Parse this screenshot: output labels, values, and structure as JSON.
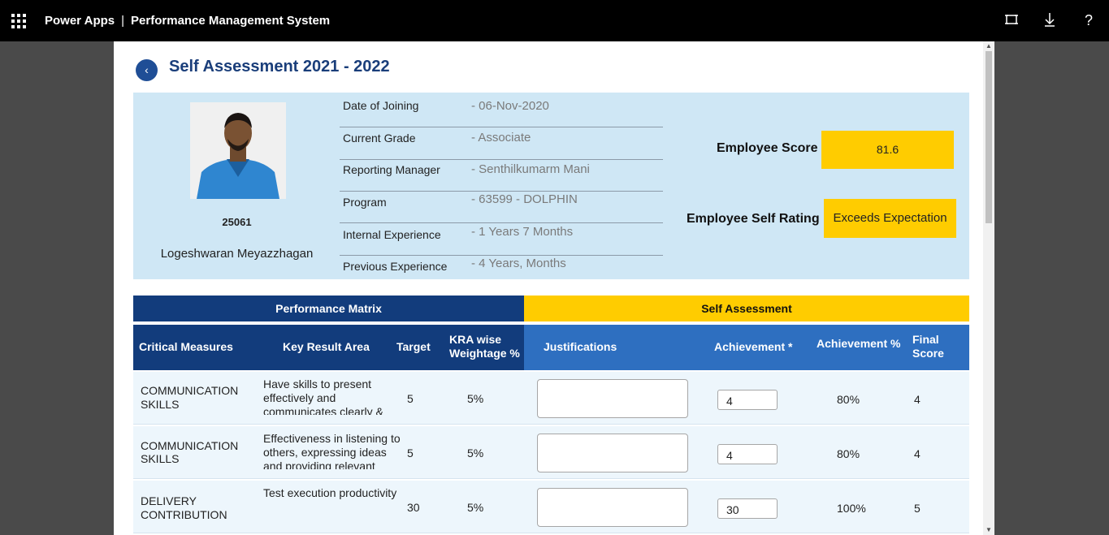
{
  "topbar": {
    "app_name": "Power Apps",
    "separator": "|",
    "app_title": "Performance Management System"
  },
  "page": {
    "title": "Self Assessment 2021 - 2022"
  },
  "employee": {
    "id": "25061",
    "name": "Logeshwaran Meyazzhagan",
    "details": [
      {
        "label": "Date of Joining",
        "value": "- 06-Nov-2020"
      },
      {
        "label": "Current Grade",
        "value": "- Associate"
      },
      {
        "label": "Reporting Manager",
        "value": "- Senthilkumarm Mani"
      },
      {
        "label": "Program",
        "value": "- 63599 - DOLPHIN"
      },
      {
        "label": "Internal Experience",
        "value": "- 1 Years   7 Months"
      },
      {
        "label": "Previous Experience",
        "value": "- 4 Years,  Months"
      }
    ],
    "score_label": "Employee Score",
    "score_value": "81.6",
    "rating_label": "Employee Self Rating",
    "rating_value": "Exceeds Expectation"
  },
  "table": {
    "band_left": "Performance Matrix",
    "band_right": "Self Assessment",
    "headers": {
      "critical_measures": "Critical Measures",
      "key_result_area": "Key Result Area",
      "target": "Target",
      "kra_weightage_1": "KRA wise",
      "kra_weightage_2": "Weightage %",
      "justifications": "Justifications",
      "achievement": "Achievement *",
      "achievement_pct": "Achievement %",
      "final_score_1": "Final",
      "final_score_2": "Score"
    },
    "rows": [
      {
        "measure_1": "COMMUNICATION",
        "measure_2": "SKILLS",
        "kra": "Have skills to present effectively and communicates clearly & effectively",
        "target": "5",
        "weight": "5%",
        "justification": "",
        "achievement": "4",
        "achievement_pct": "80%",
        "final_score": "4"
      },
      {
        "measure_1": "COMMUNICATION",
        "measure_2": "SKILLS",
        "kra": "Effectiveness in listening to others, expressing ideas and providing relevant inputs",
        "target": "5",
        "weight": "5%",
        "justification": "",
        "achievement": "4",
        "achievement_pct": "80%",
        "final_score": "4"
      },
      {
        "measure_1": "DELIVERY",
        "measure_2": "CONTRIBUTION",
        "kra": "Test execution productivity",
        "target": "30",
        "weight": "5%",
        "justification": "",
        "achievement": "30",
        "achievement_pct": "100%",
        "final_score": "5"
      }
    ]
  },
  "colors": {
    "topbar": "#000000",
    "header_navy": "#123c7c",
    "header_blue": "#2e6fc0",
    "accent_yellow": "#ffcc00",
    "profile_bg": "#cfe7f5"
  }
}
